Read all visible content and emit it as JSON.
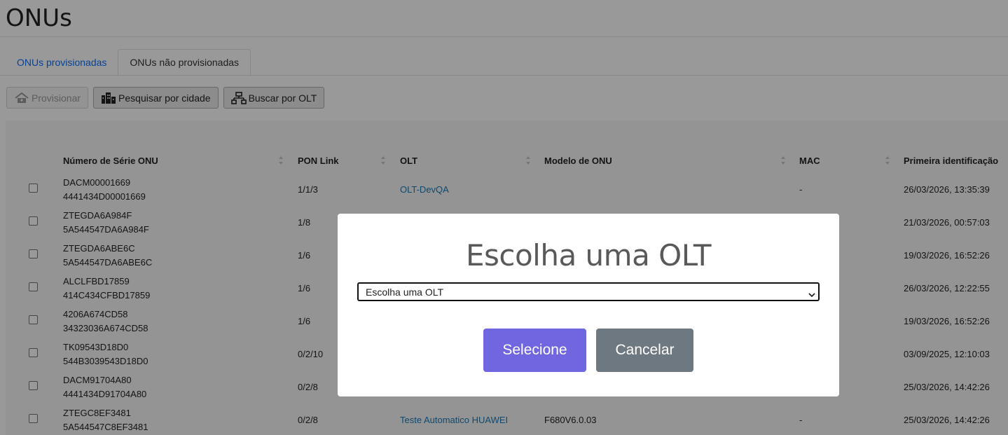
{
  "page": {
    "title": "ONUs"
  },
  "tabs": [
    {
      "label": "ONUs provisionadas",
      "active": false
    },
    {
      "label": "ONUs não provisionadas",
      "active": true
    }
  ],
  "toolbar": {
    "provision_label": "Provisionar",
    "search_city_label": "Pesquisar por cidade",
    "search_olt_label": "Buscar por OLT"
  },
  "table": {
    "headers": {
      "serial": "Número de Série ONU",
      "pon": "PON Link",
      "olt": "OLT",
      "model": "Modelo de ONU",
      "mac": "MAC",
      "first_seen": "Primeira identificação"
    },
    "rows": [
      {
        "serial": "DACM00001669",
        "serial_hex": "4441434D00001669",
        "pon": "1/1/3",
        "olt": "OLT-DevQA",
        "model": "",
        "mac": "-",
        "first_seen": "26/03/2026, 13:35:39"
      },
      {
        "serial": "ZTEGDA6A984F",
        "serial_hex": "5A544547DA6A984F",
        "pon": "1/8",
        "olt": "",
        "model": "",
        "mac": "",
        "first_seen": "21/03/2026, 00:57:03"
      },
      {
        "serial": "ZTEGDA6ABE6C",
        "serial_hex": "5A544547DA6ABE6C",
        "pon": "1/6",
        "olt": "",
        "model": "",
        "mac": "",
        "first_seen": "19/03/2026, 16:52:26"
      },
      {
        "serial": "ALCLFBD17859",
        "serial_hex": "414C434CFBD17859",
        "pon": "1/6",
        "olt": "",
        "model": "",
        "mac": "",
        "first_seen": "26/03/2026, 12:22:55"
      },
      {
        "serial": "4206A674CD58",
        "serial_hex": "34323036A674CD58",
        "pon": "1/6",
        "olt": "",
        "model": "",
        "mac": "",
        "first_seen": "19/03/2026, 16:52:26"
      },
      {
        "serial": "TK09543D18D0",
        "serial_hex": "544B3039543D18D0",
        "pon": "0/2/10",
        "olt": "",
        "model": "",
        "mac": "",
        "first_seen": "03/09/2025, 12:10:03"
      },
      {
        "serial": "DACM91704A80",
        "serial_hex": "4441434D91704A80",
        "pon": "0/2/8",
        "olt": "",
        "model": "",
        "mac": "",
        "first_seen": "25/03/2026, 14:42:26"
      },
      {
        "serial": "ZTEGC8EF3481",
        "serial_hex": "5A544547C8EF3481",
        "pon": "0/2/8",
        "olt": "Teste Automatico HUAWEI",
        "model": "F680V6.0.03",
        "mac": "-",
        "first_seen": "25/03/2026, 14:42:26"
      }
    ]
  },
  "modal": {
    "title": "Escolha uma OLT",
    "select_value": "Escolha uma OLT",
    "confirm_label": "Selecione",
    "cancel_label": "Cancelar",
    "colors": {
      "confirm": "#7066e0",
      "cancel": "#6e7881"
    }
  },
  "icons": {
    "provision": "house-wifi-icon",
    "city": "city-buildings-icon",
    "olt": "network-tree-icon",
    "sort": "sort-arrows-icon",
    "select": "chevron-down-icon"
  }
}
